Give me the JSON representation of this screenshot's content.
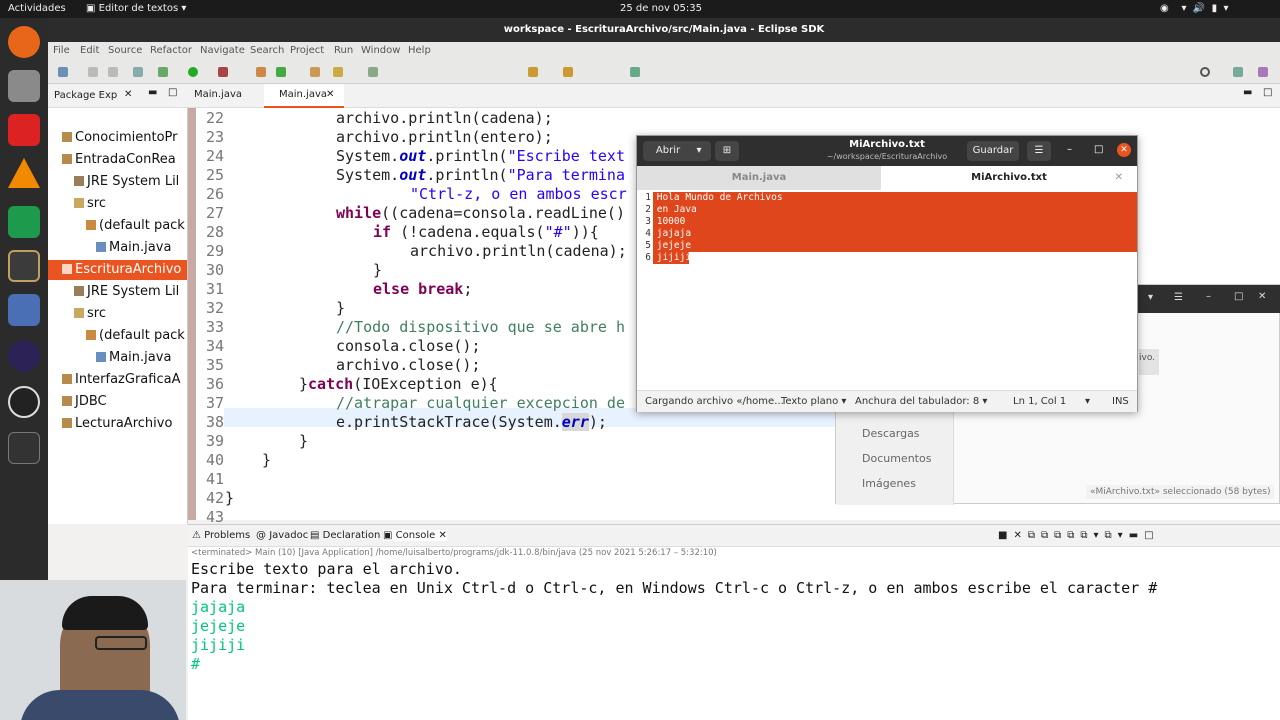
{
  "topbar": {
    "activities": "Actividades",
    "app_menu": "Editor de textos",
    "clock": "25 de nov  05:35"
  },
  "eclipse": {
    "title": "workspace - EscrituraArchivo/src/Main.java - Eclipse SDK",
    "menu": [
      "File",
      "Edit",
      "Source",
      "Refactor",
      "Navigate",
      "Search",
      "Project",
      "Run",
      "Window",
      "Help"
    ],
    "package_explorer": {
      "tab": "Package Exp",
      "items": [
        {
          "label": "ConocimientoPr",
          "kind": "project"
        },
        {
          "label": "EntradaConRea",
          "kind": "project"
        },
        {
          "label": "JRE System Lil",
          "kind": "lib"
        },
        {
          "label": "src",
          "kind": "folder"
        },
        {
          "label": "(default pack",
          "kind": "package"
        },
        {
          "label": "Main.java",
          "kind": "file"
        },
        {
          "label": "EscrituraArchivo",
          "kind": "project-selected"
        },
        {
          "label": "JRE System Lil",
          "kind": "lib"
        },
        {
          "label": "src",
          "kind": "folder"
        },
        {
          "label": "(default pack",
          "kind": "package"
        },
        {
          "label": "Main.java",
          "kind": "file"
        },
        {
          "label": "InterfazGraficaA",
          "kind": "project"
        },
        {
          "label": "JDBC",
          "kind": "project"
        },
        {
          "label": "LecturaArchivo",
          "kind": "project"
        }
      ]
    },
    "editor_tabs": [
      "Main.java",
      "Main.java"
    ],
    "line_numbers": [
      "22",
      "23",
      "24",
      "25",
      "26",
      "27",
      "28",
      "29",
      "30",
      "31",
      "32",
      "33",
      "34",
      "35",
      "36",
      "37",
      "38",
      "39",
      "40",
      "41",
      "42",
      "43"
    ],
    "code_lines": [
      "archivo.println(cadena);",
      "archivo.println(entero);",
      "System.out.println(\"Escribe text",
      "System.out.println(\"Para termina",
      "\"Ctrl-z, o en ambos escr",
      "while((cadena=consola.readLine()",
      "if (!cadena.equals(\"#\")){",
      "archivo.println(cadena);",
      "}",
      "else break;",
      "}",
      "//Todo dispositivo que se abre h",
      "consola.close();",
      "archivo.close();",
      "}catch(IOException e){",
      "//atrapar cualquier excepcion de",
      "e.printStackTrace(System.err);",
      "}",
      "}",
      "",
      "}",
      ""
    ],
    "console": {
      "tabs": [
        "Problems",
        "Javadoc",
        "Declaration",
        "Console"
      ],
      "status": "<terminated> Main (10) [Java Application] /home/luisalberto/programs/jdk-11.0.8/bin/java  (25 nov 2021 5:26:17 – 5:32:10)",
      "output": [
        "Escribe texto para el archivo.",
        "Para terminar: teclea en Unix Ctrl-d o Ctrl-c, en Windows Ctrl-c o Ctrl-z, o en ambos escribe el caracter #"
      ],
      "input": [
        "jajaja",
        "jejeje",
        "jijiji",
        "#"
      ]
    }
  },
  "gedit": {
    "open": "Abrir",
    "title": "MiArchivo.txt",
    "path": "~/workspace/EscrituraArchivo",
    "save": "Guardar",
    "tabs": [
      "Main.java",
      "MiArchivo.txt"
    ],
    "lines": [
      {
        "n": "1",
        "t": "Hola Mundo de Archivos"
      },
      {
        "n": "2",
        "t": "en Java"
      },
      {
        "n": "3",
        "t": "10000"
      },
      {
        "n": "4",
        "t": "jajaja"
      },
      {
        "n": "5",
        "t": "jejeje"
      },
      {
        "n": "6",
        "t": "jijiji"
      }
    ],
    "status": {
      "loading": "Cargando archivo «/home...",
      "lang": "Texto plano",
      "tab_width": "Anchura del tabulador: 8",
      "position": "Ln 1, Col 1",
      "mode": "INS"
    },
    "selection_color": "#e0461c"
  },
  "files_window": {
    "partial": "ivo.",
    "places": [
      "Descargas",
      "Documentos",
      "Imágenes"
    ],
    "selected": "«MiArchivo.txt» seleccionado  (58 bytes)"
  }
}
